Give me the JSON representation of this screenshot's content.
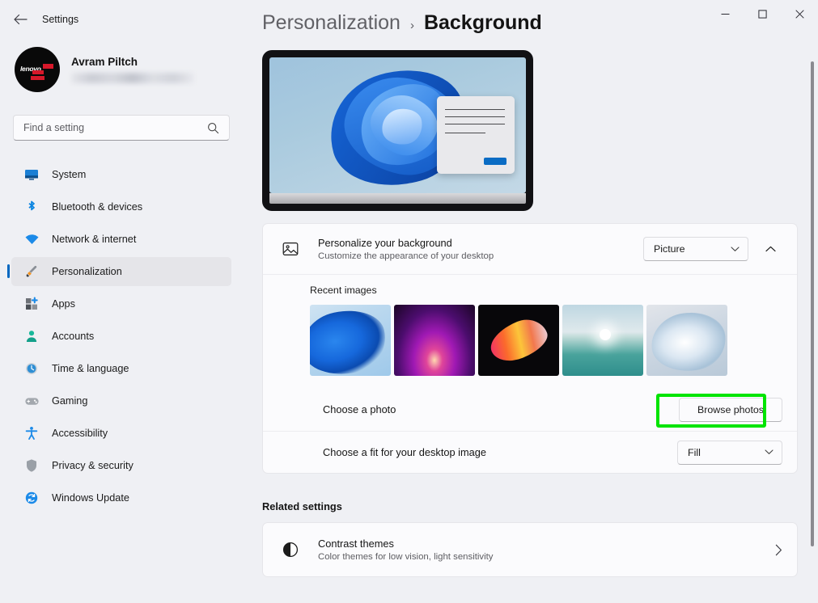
{
  "window": {
    "app_title": "Settings",
    "back_icon": "back-arrow-icon",
    "minimize_label": "─",
    "maximize_label": "□",
    "close_label": "✕"
  },
  "profile": {
    "name": "Avram Piltch",
    "email_redacted": "",
    "avatar_brand": "lenovo"
  },
  "search": {
    "placeholder": "Find a setting",
    "value": "",
    "icon": "search-icon"
  },
  "sidebar": {
    "items": [
      {
        "label": "System",
        "icon": "monitor-icon",
        "selected": false
      },
      {
        "label": "Bluetooth & devices",
        "icon": "bluetooth-icon",
        "selected": false
      },
      {
        "label": "Network & internet",
        "icon": "wifi-icon",
        "selected": false
      },
      {
        "label": "Personalization",
        "icon": "paintbrush-icon",
        "selected": true
      },
      {
        "label": "Apps",
        "icon": "apps-grid-icon",
        "selected": false
      },
      {
        "label": "Accounts",
        "icon": "person-icon",
        "selected": false
      },
      {
        "label": "Time & language",
        "icon": "clock-icon",
        "selected": false
      },
      {
        "label": "Gaming",
        "icon": "gamepad-icon",
        "selected": false
      },
      {
        "label": "Accessibility",
        "icon": "accessibility-icon",
        "selected": false
      },
      {
        "label": "Privacy & security",
        "icon": "shield-icon",
        "selected": false
      },
      {
        "label": "Windows Update",
        "icon": "update-refresh-icon",
        "selected": false
      }
    ]
  },
  "breadcrumb": {
    "parent": "Personalization",
    "separator": "›",
    "current": "Background"
  },
  "preview": {
    "name": "desktop-background-preview",
    "wallpaper": "windows-11-blue-bloom"
  },
  "main": {
    "personalize_row": {
      "icon": "picture-icon",
      "title": "Personalize your background",
      "subtitle": "Customize the appearance of your desktop",
      "dropdown_value": "Picture",
      "dropdown_chevron": "chevron-down-icon",
      "expander_chevron": "chevron-up-icon"
    },
    "recent_images": {
      "label": "Recent images",
      "thumbs": [
        {
          "name": "thumb-blue-bloom"
        },
        {
          "name": "thumb-purple-glow"
        },
        {
          "name": "thumb-colorful-abstract"
        },
        {
          "name": "thumb-sunset-water"
        },
        {
          "name": "thumb-white-bloom"
        }
      ]
    },
    "choose_photo_row": {
      "title": "Choose a photo",
      "button_label": "Browse photos"
    },
    "fit_row": {
      "title": "Choose a fit for your desktop image",
      "dropdown_value": "Fill",
      "dropdown_chevron": "chevron-down-icon"
    }
  },
  "related": {
    "heading": "Related settings",
    "items": [
      {
        "icon": "contrast-circle-icon",
        "title": "Contrast themes",
        "subtitle": "Color themes for low vision, light sensitivity",
        "chevron": "chevron-right-icon"
      }
    ]
  },
  "annotation": {
    "highlight_target": "Browse photos",
    "highlight_color": "#00e400"
  }
}
